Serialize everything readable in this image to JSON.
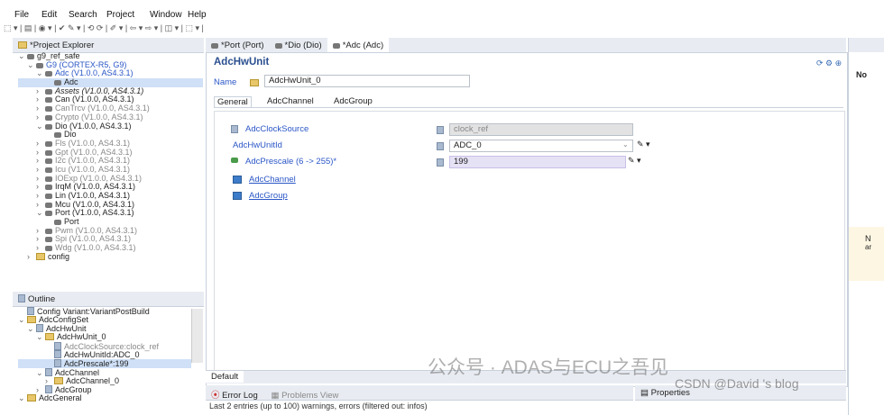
{
  "menu": [
    "File",
    "Edit",
    "Search",
    "Project",
    "Window",
    "Help"
  ],
  "toolbar_glyphs": "⬚ ▾ | ▤ | ◉ ▾ | ✔ ✎ ▾ | ⟲ ⟳ | ✐ ▾ | ⇦ ▾ ⇨ ▾ | ◫ ▾ | ⬚ ▾ |",
  "project_explorer": {
    "tab": "*Project Explorer",
    "tree": [
      {
        "indent": 0,
        "arrow": "⌄",
        "icon": "mod",
        "text": "g9_ref_safe",
        "gray": false
      },
      {
        "indent": 1,
        "arrow": "⌄",
        "icon": "mod",
        "text": "G9 (CORTEX-R5, G9)",
        "gray": false,
        "link": true
      },
      {
        "indent": 2,
        "arrow": "⌄",
        "icon": "mod",
        "text": "Adc (V1.0.0, AS4.3.1)",
        "gray": false,
        "link": true
      },
      {
        "indent": 3,
        "arrow": "",
        "icon": "mod",
        "text": "Adc",
        "gray": false,
        "selected": true
      },
      {
        "indent": 2,
        "arrow": "›",
        "icon": "mod",
        "text": "Assets (V1.0.0, AS4.3.1)",
        "gray": false,
        "italic": true
      },
      {
        "indent": 2,
        "arrow": "›",
        "icon": "mod",
        "text": "Can (V1.0.0, AS4.3.1)",
        "gray": false
      },
      {
        "indent": 2,
        "arrow": "›",
        "icon": "mod",
        "text": "CanTrcv (V1.0.0, AS4.3.1)",
        "gray": true
      },
      {
        "indent": 2,
        "arrow": "›",
        "icon": "mod",
        "text": "Crypto (V1.0.0, AS4.3.1)",
        "gray": true
      },
      {
        "indent": 2,
        "arrow": "⌄",
        "icon": "mod",
        "text": "Dio (V1.0.0, AS4.3.1)",
        "gray": false
      },
      {
        "indent": 3,
        "arrow": "",
        "icon": "mod",
        "text": "Dio",
        "gray": false
      },
      {
        "indent": 2,
        "arrow": "›",
        "icon": "mod",
        "text": "Fls (V1.0.0, AS4.3.1)",
        "gray": true
      },
      {
        "indent": 2,
        "arrow": "›",
        "icon": "mod",
        "text": "Gpt (V1.0.0, AS4.3.1)",
        "gray": true
      },
      {
        "indent": 2,
        "arrow": "›",
        "icon": "mod",
        "text": "I2c (V1.0.0, AS4.3.1)",
        "gray": true
      },
      {
        "indent": 2,
        "arrow": "›",
        "icon": "mod",
        "text": "Icu (V1.0.0, AS4.3.1)",
        "gray": true
      },
      {
        "indent": 2,
        "arrow": "›",
        "icon": "mod",
        "text": "IOExp (V1.0.0, AS4.3.1)",
        "gray": true
      },
      {
        "indent": 2,
        "arrow": "›",
        "icon": "mod",
        "text": "IrqM (V1.0.0, AS4.3.1)",
        "gray": false
      },
      {
        "indent": 2,
        "arrow": "›",
        "icon": "mod",
        "text": "Lin (V1.0.0, AS4.3.1)",
        "gray": false
      },
      {
        "indent": 2,
        "arrow": "›",
        "icon": "mod",
        "text": "Mcu (V1.0.0, AS4.3.1)",
        "gray": false
      },
      {
        "indent": 2,
        "arrow": "⌄",
        "icon": "mod",
        "text": "Port (V1.0.0, AS4.3.1)",
        "gray": false
      },
      {
        "indent": 3,
        "arrow": "",
        "icon": "mod",
        "text": "Port",
        "gray": false
      },
      {
        "indent": 2,
        "arrow": "›",
        "icon": "mod",
        "text": "Pwm (V1.0.0, AS4.3.1)",
        "gray": true
      },
      {
        "indent": 2,
        "arrow": "›",
        "icon": "mod",
        "text": "Spi (V1.0.0, AS4.3.1)",
        "gray": true
      },
      {
        "indent": 2,
        "arrow": "›",
        "icon": "mod",
        "text": "Wdg (V1.0.0, AS4.3.1)",
        "gray": true
      },
      {
        "indent": 1,
        "arrow": "›",
        "icon": "fold",
        "text": "config",
        "gray": false
      }
    ]
  },
  "outline": {
    "tab": "Outline",
    "tree": [
      {
        "indent": 0,
        "arrow": "",
        "icon": "doc",
        "text": "Config Variant:VariantPostBuild"
      },
      {
        "indent": 0,
        "arrow": "⌄",
        "icon": "fold",
        "text": "AdcConfigSet"
      },
      {
        "indent": 1,
        "arrow": "⌄",
        "icon": "doc",
        "text": "AdcHwUnit"
      },
      {
        "indent": 2,
        "arrow": "⌄",
        "icon": "fold",
        "text": "AdcHwUnit_0"
      },
      {
        "indent": 3,
        "arrow": "",
        "icon": "doc",
        "text": "AdcClockSource:clock_ref",
        "gray": true
      },
      {
        "indent": 3,
        "arrow": "",
        "icon": "doc",
        "text": "AdcHwUnitId:ADC_0"
      },
      {
        "indent": 3,
        "arrow": "",
        "icon": "doc",
        "text": "AdcPrescale*:199",
        "selected": true
      },
      {
        "indent": 2,
        "arrow": "⌄",
        "icon": "doc",
        "text": "AdcChannel"
      },
      {
        "indent": 3,
        "arrow": "›",
        "icon": "fold",
        "text": "AdcChannel_0"
      },
      {
        "indent": 2,
        "arrow": "›",
        "icon": "doc",
        "text": "AdcGroup"
      },
      {
        "indent": 0,
        "arrow": "⌄",
        "icon": "fold",
        "text": "AdcGeneral"
      }
    ]
  },
  "editor_tabs": [
    "*Port (Port)",
    "*Dio (Dio)",
    "*Adc (Adc)"
  ],
  "editor": {
    "title": "AdcHwUnit",
    "name_label": "Name",
    "name_value": "AdcHwUnit_0",
    "subtabs": [
      "General",
      "AdcChannel",
      "AdcGroup"
    ],
    "fields": [
      {
        "label": "AdcClockSource",
        "value": "clock_ref",
        "disabled": true
      },
      {
        "label": "AdcHwUnitId",
        "value": "ADC_0",
        "disabled": false
      },
      {
        "label": "AdcPrescale (6 -> 255)*",
        "value": "199",
        "disabled": false,
        "highlight": true
      }
    ],
    "links": [
      "AdcChannel",
      "AdcGroup"
    ],
    "bottom_tab": "Default"
  },
  "bottom": {
    "error_tab": "Error Log",
    "problems_tab": "Problems View",
    "status": "Last 2 entries (up to 100) warnings, errors (filtered out: infos)",
    "properties_tab": "Properties"
  },
  "right_panel": {
    "text1": "No",
    "text2": "N",
    "text3": "ar"
  },
  "watermark": "公众号 · ADAS与ECU之吾见",
  "watermark2": "CSDN @David 's blog"
}
